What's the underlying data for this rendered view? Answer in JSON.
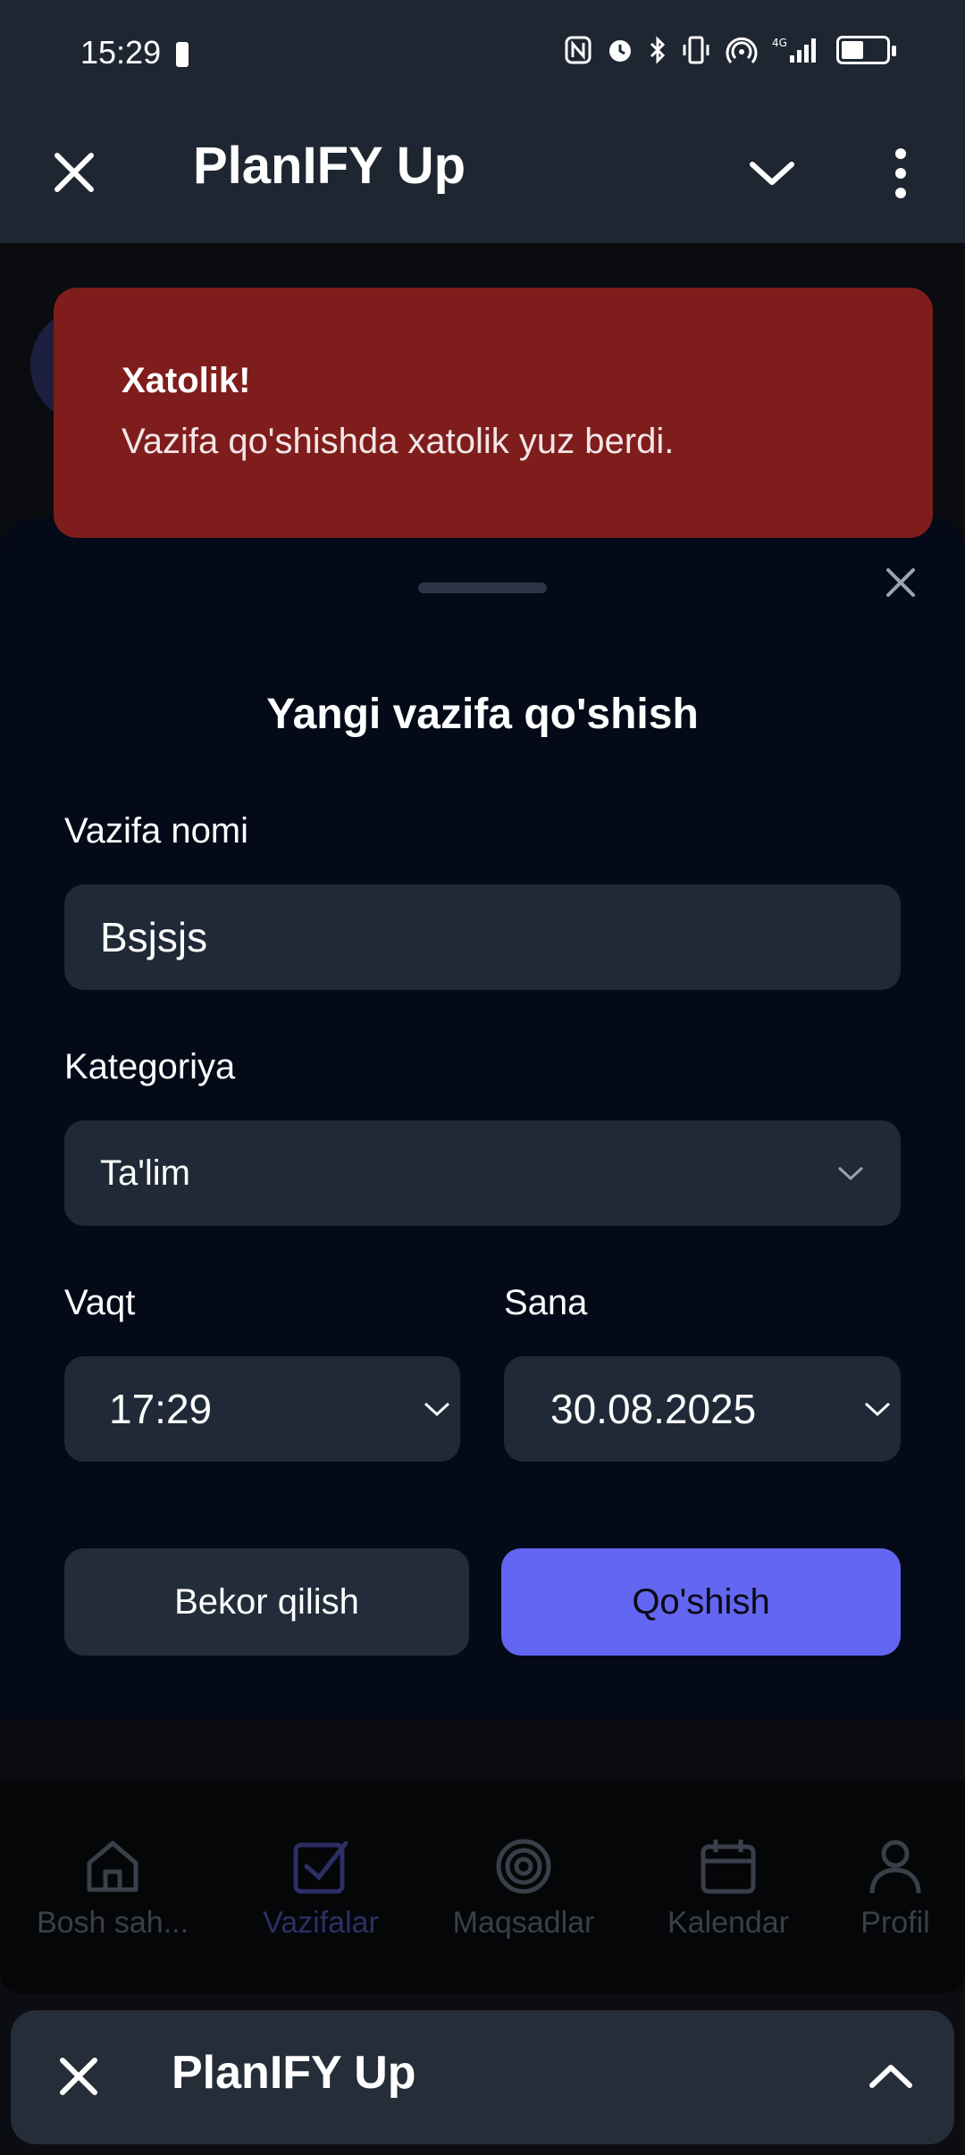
{
  "status_bar": {
    "time": "15:29",
    "icons": [
      "nfc-icon",
      "alarm-icon",
      "bluetooth-icon",
      "vibrate-icon",
      "hotspot-icon",
      "signal-4g-icon",
      "battery-icon"
    ]
  },
  "app_bar": {
    "title": "PlanIFY Up"
  },
  "toast": {
    "title": "Xatolik!",
    "message": "Vazifa qo'shishda xatolik yuz berdi.",
    "color": "#7f1d1d"
  },
  "sheet": {
    "title": "Yangi vazifa qo'shish",
    "task_name_label": "Vazifa nomi",
    "task_name_value": "Bsjsjs",
    "category_label": "Kategoriya",
    "category_value": "Ta'lim",
    "time_label": "Vaqt",
    "time_value": "17:29",
    "date_label": "Sana",
    "date_value": "30.08.2025",
    "cancel_label": "Bekor qilish",
    "add_label": "Qo'shish",
    "accent": "#6366f1"
  },
  "bottom_nav": {
    "items": [
      {
        "label": "Bosh sah...",
        "icon": "home-icon"
      },
      {
        "label": "Vazifalar",
        "icon": "checkbox-icon"
      },
      {
        "label": "Maqsadlar",
        "icon": "target-icon"
      },
      {
        "label": "Kalendar",
        "icon": "calendar-icon"
      },
      {
        "label": "Profil",
        "icon": "user-icon"
      }
    ]
  },
  "taskbar": {
    "title": "PlanIFY Up"
  }
}
